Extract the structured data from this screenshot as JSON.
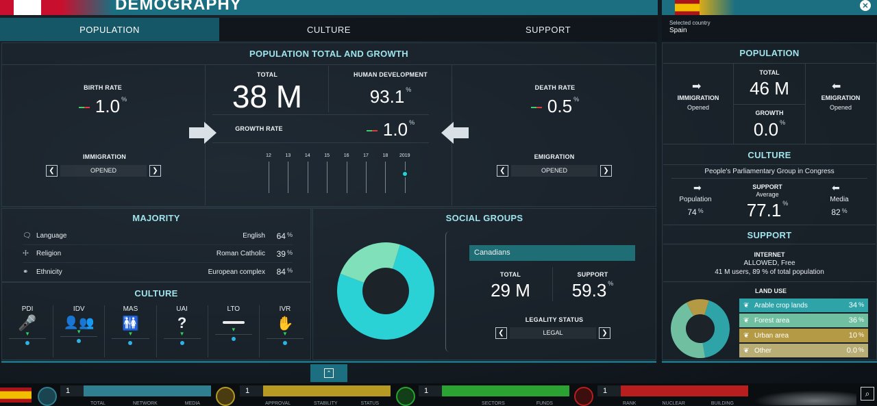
{
  "header": {
    "title": "DEMOGRAPHY"
  },
  "tabs": [
    {
      "label": "POPULATION"
    },
    {
      "label": "CULTURE"
    },
    {
      "label": "SUPPORT"
    }
  ],
  "pop_growth": {
    "title": "POPULATION TOTAL AND GROWTH",
    "birth_rate": {
      "label": "BIRTH RATE",
      "value": "1.0",
      "unit": "%"
    },
    "total": {
      "label": "TOTAL",
      "value": "38 M"
    },
    "hdi": {
      "label": "HUMAN DEVELOPMENT",
      "value": "93.1",
      "unit": "%"
    },
    "growth": {
      "label": "GROWTH RATE",
      "value": "1.0",
      "unit": "%"
    },
    "death_rate": {
      "label": "DEATH RATE",
      "value": "0.5",
      "unit": "%"
    },
    "immigration": {
      "label": "IMMIGRATION",
      "value": "OPENED"
    },
    "emigration": {
      "label": "EMIGRATION",
      "value": "OPENED"
    },
    "timeline": [
      "12",
      "13",
      "14",
      "15",
      "16",
      "17",
      "18",
      "2019"
    ]
  },
  "majority": {
    "title": "MAJORITY",
    "rows": [
      {
        "label": "Language",
        "value": "English",
        "pct": "64",
        "icon": "language-icon"
      },
      {
        "label": "Religion",
        "value": "Roman Catholic",
        "pct": "39",
        "icon": "religion-icon"
      },
      {
        "label": "Ethnicity",
        "value": "European complex",
        "pct": "84",
        "icon": "ethnicity-icon"
      }
    ],
    "unit": "%"
  },
  "culture": {
    "title": "CULTURE",
    "dims": [
      {
        "label": "PDI",
        "icon": "microphone-icon"
      },
      {
        "label": "IDV",
        "icon": "people-icon"
      },
      {
        "label": "MAS",
        "icon": "couple-icon"
      },
      {
        "label": "UAI",
        "icon": "question-icon"
      },
      {
        "label": "LTO",
        "icon": "cigar-icon"
      },
      {
        "label": "IVR",
        "icon": "hand-icon"
      }
    ]
  },
  "social": {
    "title": "SOCIAL GROUPS",
    "group": "Canadians",
    "total_label": "TOTAL",
    "total": "29 M",
    "support_label": "SUPPORT",
    "support": "59.3",
    "unit": "%",
    "legality_label": "LEGALITY STATUS",
    "legality": "LEGAL",
    "donut_fractions": [
      0.76,
      0.24
    ],
    "donut_colors": [
      "#2ad2d6",
      "#7fe0b9"
    ]
  },
  "right": {
    "selected_label": "Selected country",
    "country": "Spain",
    "population_title": "POPULATION",
    "immigration": {
      "label": "IMMIGRATION",
      "value": "Opened"
    },
    "total": {
      "label": "TOTAL",
      "value": "46 M"
    },
    "emigration": {
      "label": "EMIGRATION",
      "value": "Opened"
    },
    "growth": {
      "label": "GROWTH",
      "value": "0.0",
      "unit": "%"
    },
    "culture_title": "CULTURE",
    "party": "People's Parliamentary Group in Congress",
    "c_population": {
      "label": "Population",
      "value": "74",
      "unit": "%"
    },
    "c_support": {
      "label": "SUPPORT",
      "sub": "Average",
      "value": "77.1",
      "unit": "%"
    },
    "c_media": {
      "label": "Media",
      "value": "82",
      "unit": "%"
    },
    "support_title": "SUPPORT",
    "internet": {
      "label": "INTERNET",
      "status": "ALLOWED, Free",
      "users": "41 M users, 89 % of total population"
    },
    "land_use": {
      "label": "LAND USE",
      "items": [
        {
          "label": "Arable crop lands",
          "pct": "34",
          "value": 34,
          "color": "#2ea3a8"
        },
        {
          "label": "Forest area",
          "pct": "36",
          "value": 36,
          "color": "#6fbfa0"
        },
        {
          "label": "Urban area",
          "pct": "10",
          "value": 10,
          "color": "#b59a45"
        },
        {
          "label": "Other",
          "pct": "0.0",
          "value": 0,
          "color": "#b8ad74"
        }
      ],
      "unit": "%"
    }
  },
  "bottom": {
    "groups": [
      {
        "num": "1",
        "color": "#2f7f90",
        "labels": [
          "TOTAL",
          "NETWORK",
          "MEDIA"
        ]
      },
      {
        "num": "1",
        "color": "#b79a21",
        "labels": [
          "APPROVAL",
          "STABILITY",
          "STATUS"
        ]
      },
      {
        "num": "1",
        "color": "#2aa332",
        "labels": [
          "SECTORS",
          "FUNDS"
        ]
      },
      {
        "num": "1",
        "color": "#b91e1e",
        "labels": [
          "RANK",
          "NUCLEAR",
          "BUILDING"
        ]
      }
    ]
  }
}
